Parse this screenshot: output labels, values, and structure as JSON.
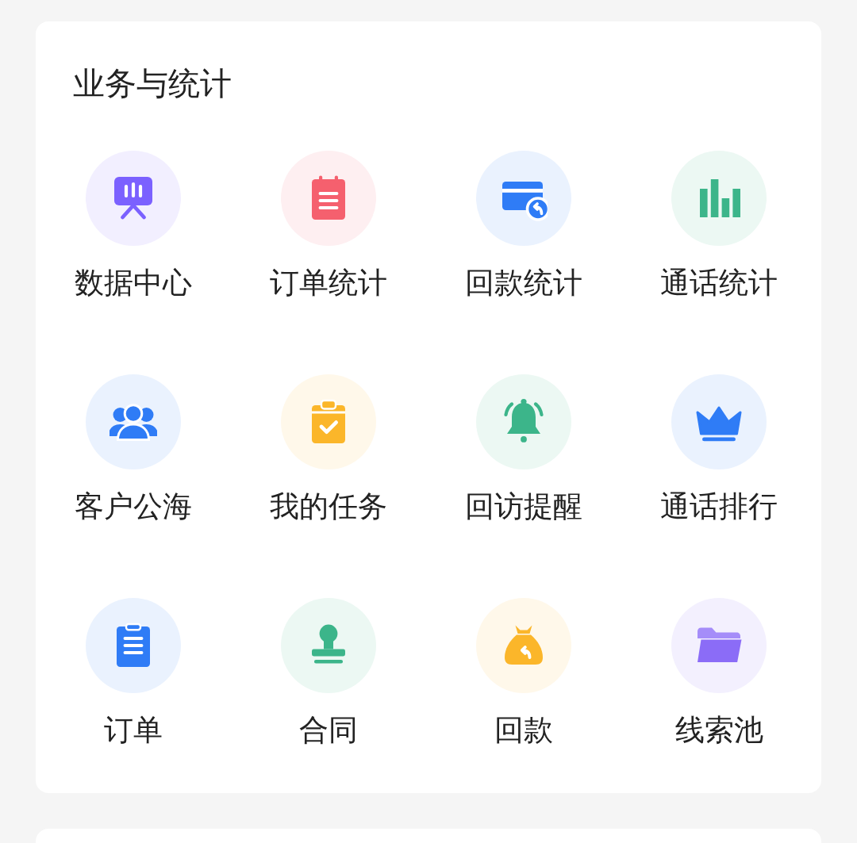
{
  "section": {
    "title": "业务与统计",
    "items": [
      {
        "label": "数据中心",
        "kind": "presentation",
        "color": "#7b61ff"
      },
      {
        "label": "订单统计",
        "kind": "notepad",
        "color": "#f5606e"
      },
      {
        "label": "回款统计",
        "kind": "card-return",
        "color": "#2f7cf6"
      },
      {
        "label": "通话统计",
        "kind": "bar-chart",
        "color": "#3cb58a"
      },
      {
        "label": "客户公海",
        "kind": "users",
        "color": "#2f7cf6"
      },
      {
        "label": "我的任务",
        "kind": "clipboard-check",
        "color": "#fbb62a"
      },
      {
        "label": "回访提醒",
        "kind": "bell",
        "color": "#3cb58a"
      },
      {
        "label": "通话排行",
        "kind": "crown",
        "color": "#2f7cf6"
      },
      {
        "label": "订单",
        "kind": "clipboard",
        "color": "#2f7cf6"
      },
      {
        "label": "合同",
        "kind": "stamp",
        "color": "#3cb58a"
      },
      {
        "label": "回款",
        "kind": "money-bag",
        "color": "#fbb62a"
      },
      {
        "label": "线索池",
        "kind": "folder",
        "color": "#8b6cf7"
      }
    ]
  }
}
